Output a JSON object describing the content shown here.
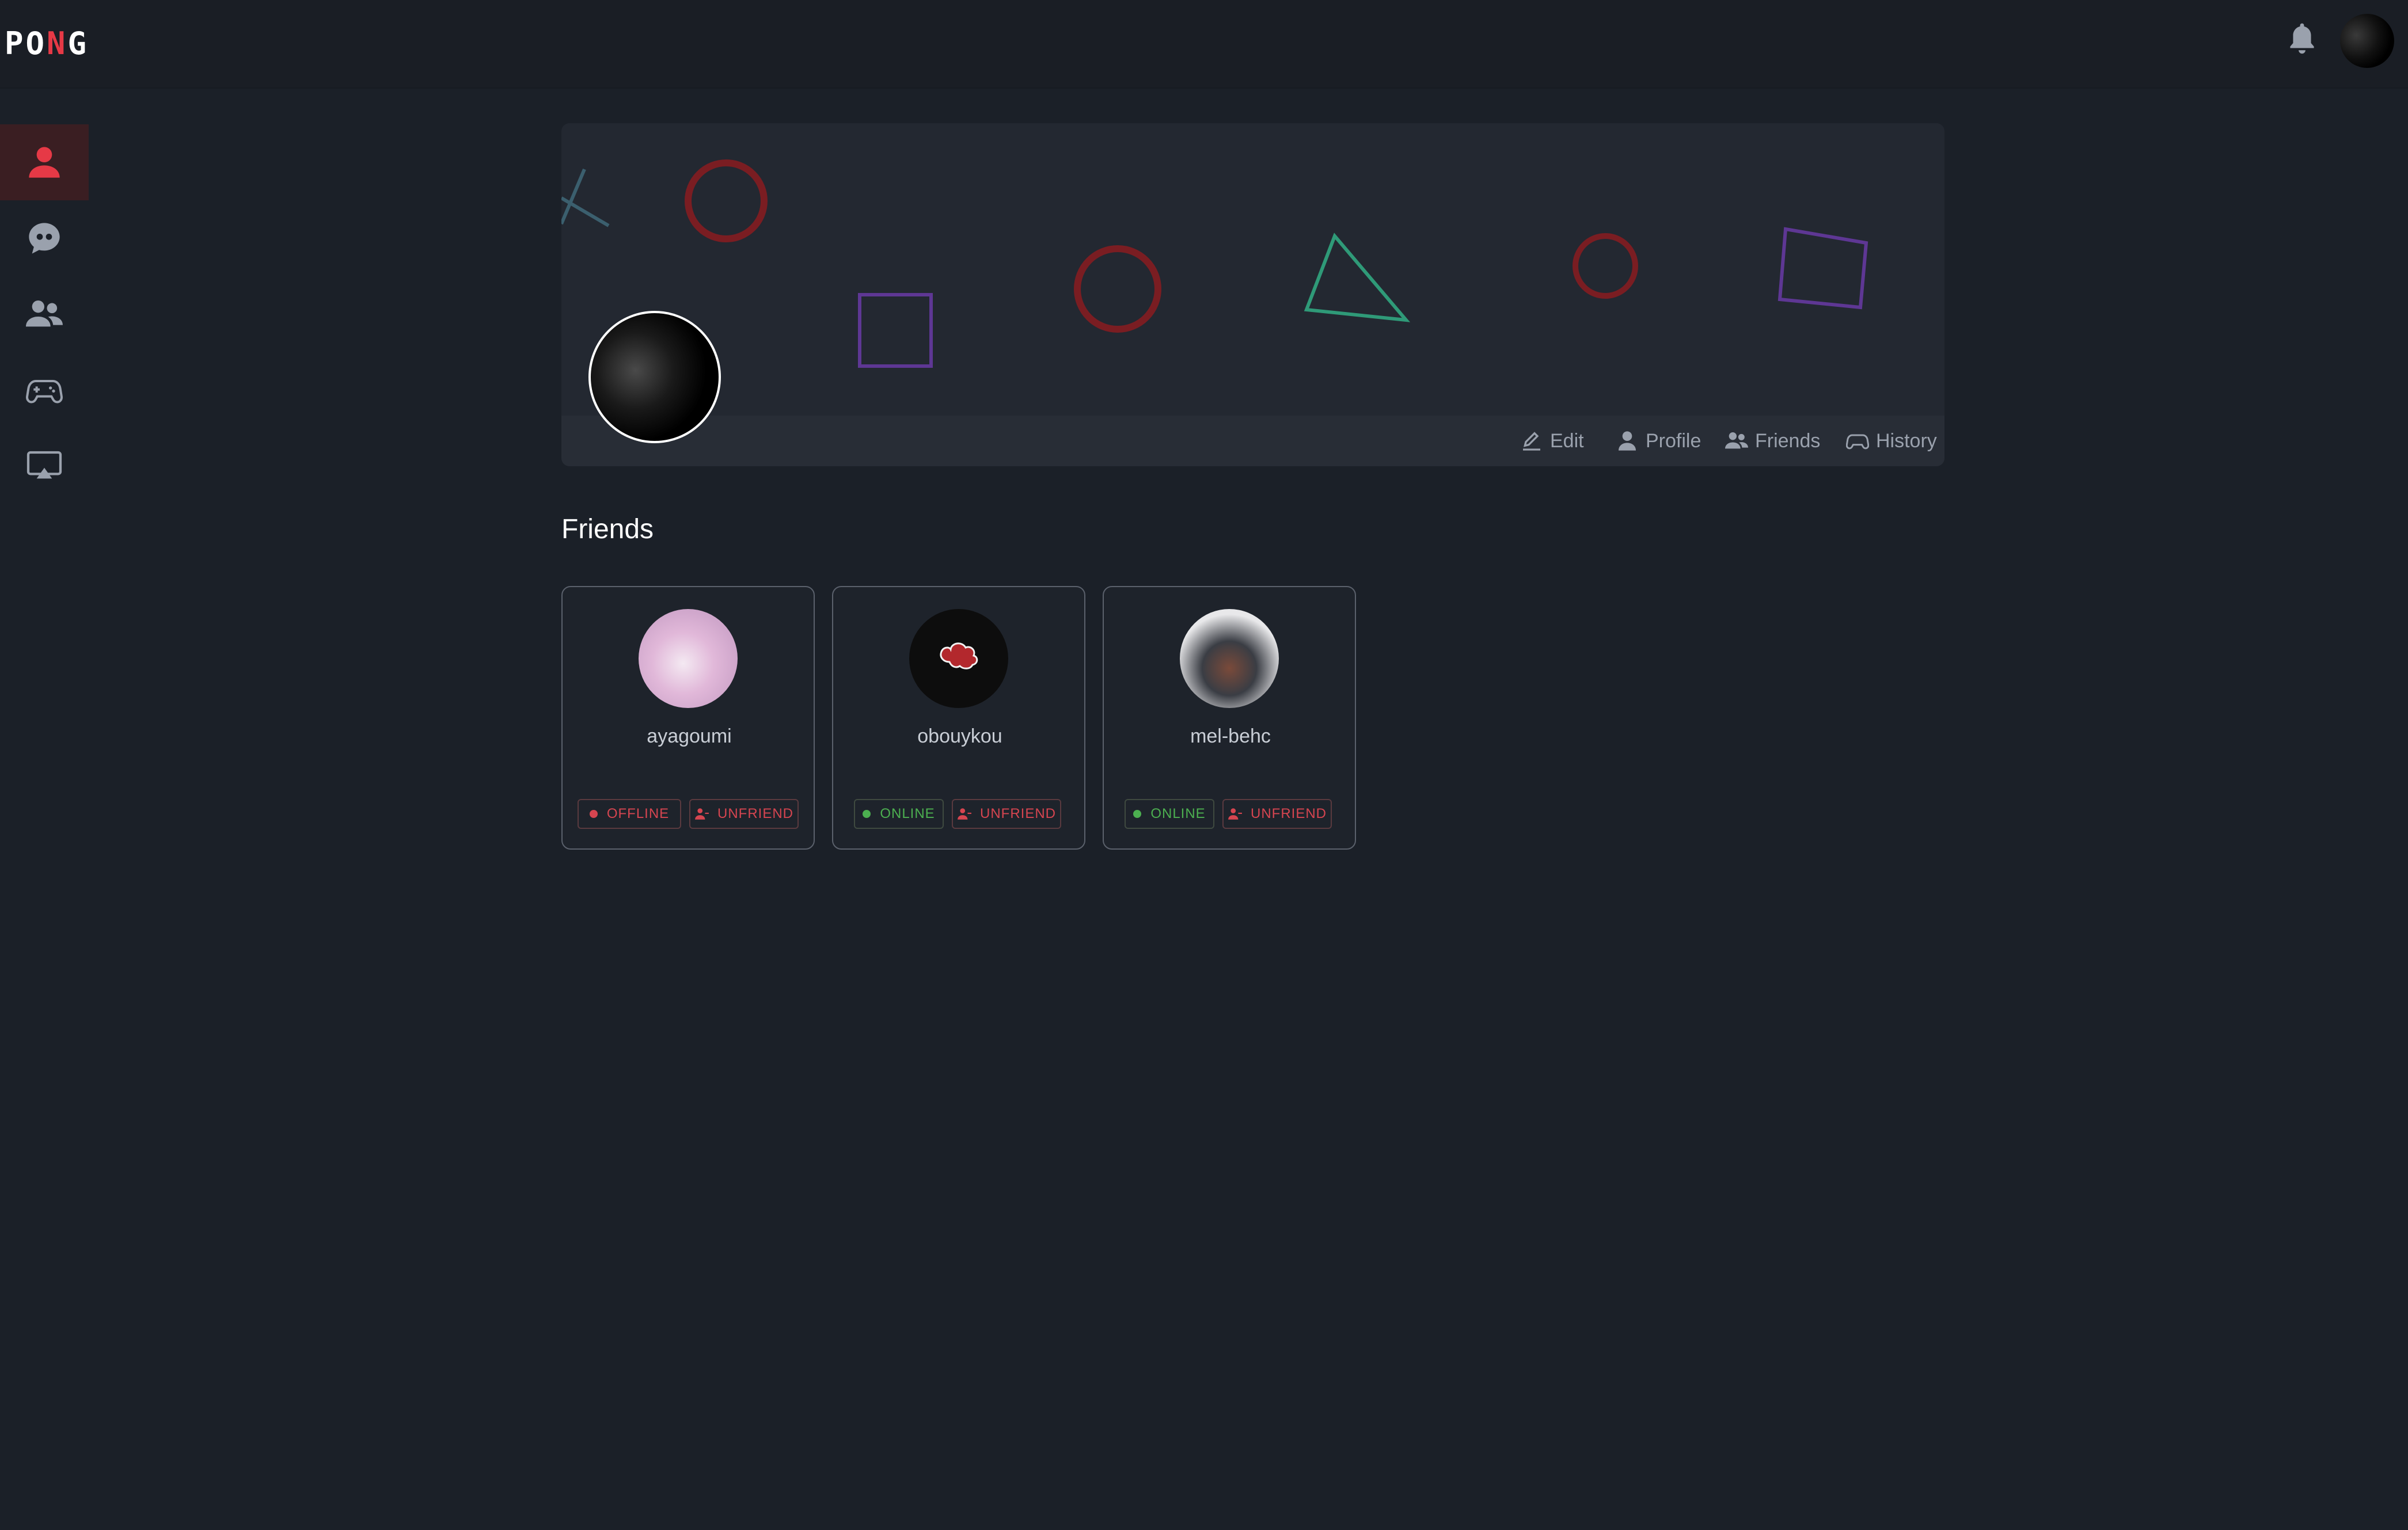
{
  "header": {
    "logo": {
      "text_a": "PO",
      "text_accent": "N",
      "text_b": "G"
    }
  },
  "icons": {
    "bell": "bell-icon",
    "sidebar": [
      "user-icon",
      "chat-quote-icon",
      "users-icon",
      "gamepad-icon",
      "screen-cast-icon"
    ]
  },
  "colors": {
    "accent": "#e63946",
    "online": "#4caf50",
    "offline": "#d64550"
  },
  "banner": {
    "nav": [
      {
        "label": "Edit"
      },
      {
        "label": "Profile"
      },
      {
        "label": "Friends"
      },
      {
        "label": "History"
      }
    ]
  },
  "section": {
    "title": "Friends"
  },
  "friends": [
    {
      "name": "ayagoumi",
      "status": "OFFLINE",
      "action": "UNFRIEND"
    },
    {
      "name": "obouykou",
      "status": "ONLINE",
      "action": "UNFRIEND"
    },
    {
      "name": "mel-behc",
      "status": "ONLINE",
      "action": "UNFRIEND"
    }
  ]
}
